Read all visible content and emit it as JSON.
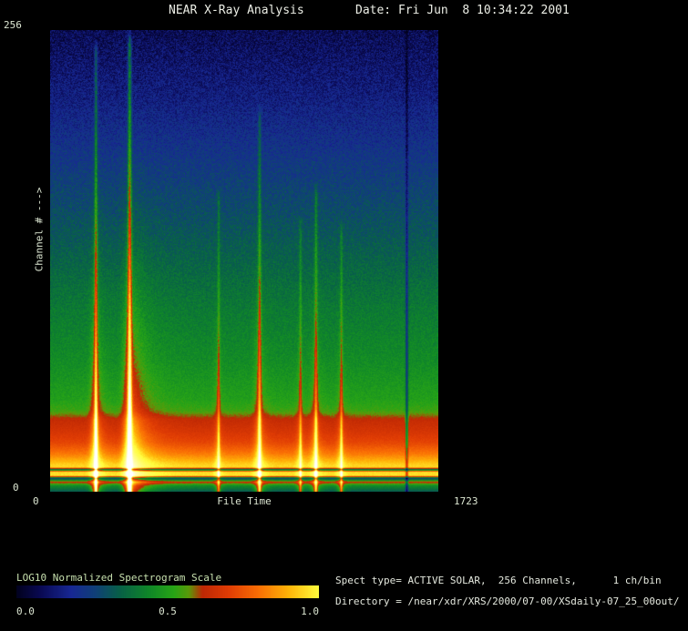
{
  "header": {
    "title": "NEAR X-Ray Analysis",
    "date": "Date: Fri Jun  8 10:34:22 2001"
  },
  "plot": {
    "y_axis": {
      "label": "Channel # --->",
      "max": "256",
      "min": "0"
    },
    "x_axis": {
      "label": "File Time",
      "min": "0",
      "max": "1723"
    }
  },
  "colorbar": {
    "title": "LOG10 Normalized Spectrogram Scale",
    "ticks": [
      "0.0",
      "0.5",
      "1.0"
    ]
  },
  "info": {
    "spect_type": "Spect type= ACTIVE SOLAR,  256 Channels,      1 ch/bin",
    "directory": "Directory = /near/xdr/XRS/2000/07-00/XSdaily-07_25_00out/"
  },
  "colors": {
    "background": "#000000",
    "text": "#dce6d2",
    "scale_title_text": "#c7e0ae"
  },
  "chart_data": {
    "type": "heatmap",
    "title": "NEAR X-Ray Analysis",
    "xlabel": "File Time",
    "ylabel": "Channel #",
    "xlim": [
      0,
      1723
    ],
    "ylim": [
      0,
      256
    ],
    "colorbar_label": "LOG10 Normalized Spectrogram Scale",
    "colorbar_range": [
      0.0,
      1.0
    ],
    "spect_type": "ACTIVE SOLAR",
    "n_channels": 256,
    "ch_per_bin": 1,
    "description": "Log10-normalized X-ray spectrogram. Background intensity rises toward low channel numbers (blue at high channels, green mid, red/orange/yellow bands at lowest channels). Vertical streaks are solar X-ray flare events at the listed file times; negative-amplitude entry is a dark data-dropout column.",
    "flare_events": [
      {
        "t": 202,
        "amp": 0.62,
        "top": 0.02,
        "core_w": 5,
        "tail": 20
      },
      {
        "t": 352,
        "amp": 0.88,
        "top": 0.0,
        "core_w": 6,
        "tail": 58
      },
      {
        "t": 748,
        "amp": 0.32,
        "top": 0.34,
        "core_w": 4,
        "tail": 10
      },
      {
        "t": 930,
        "amp": 0.46,
        "top": 0.16,
        "core_w": 5,
        "tail": 18
      },
      {
        "t": 1112,
        "amp": 0.3,
        "top": 0.4,
        "core_w": 4,
        "tail": 12
      },
      {
        "t": 1181,
        "amp": 0.42,
        "top": 0.33,
        "core_w": 5,
        "tail": 15
      },
      {
        "t": 1294,
        "amp": 0.34,
        "top": 0.41,
        "core_w": 4,
        "tail": 12
      },
      {
        "t": 1585,
        "amp": -0.3,
        "top": 0.0,
        "core_w": 4,
        "tail": 0
      }
    ],
    "background_profile": [
      [
        0.0,
        0.08
      ],
      [
        0.15,
        0.15
      ],
      [
        0.3,
        0.24
      ],
      [
        0.45,
        0.32
      ],
      [
        0.6,
        0.4
      ],
      [
        0.72,
        0.45
      ],
      [
        0.8,
        0.5
      ],
      [
        0.825,
        0.54
      ],
      [
        0.845,
        0.63
      ],
      [
        0.87,
        0.67
      ],
      [
        0.895,
        0.72
      ],
      [
        0.92,
        0.82
      ],
      [
        0.94,
        0.93
      ],
      [
        0.948,
        0.96
      ],
      [
        0.953,
        0.32
      ],
      [
        0.958,
        0.95
      ],
      [
        0.966,
        0.97
      ],
      [
        0.972,
        0.25
      ],
      [
        0.98,
        0.65
      ],
      [
        0.988,
        0.45
      ],
      [
        1.0,
        0.33
      ]
    ],
    "noise_profile": [
      [
        0.0,
        0.16
      ],
      [
        0.3,
        0.11
      ],
      [
        0.6,
        0.08
      ],
      [
        0.8,
        0.05
      ],
      [
        0.84,
        0.03
      ],
      [
        1.0,
        0.03
      ]
    ],
    "colormap_stops": [
      [
        0.0,
        [
          2,
          2,
          30
        ]
      ],
      [
        0.08,
        [
          10,
          10,
          84
        ]
      ],
      [
        0.18,
        [
          24,
          40,
          148
        ]
      ],
      [
        0.26,
        [
          16,
          64,
          120
        ]
      ],
      [
        0.34,
        [
          8,
          96,
          72
        ]
      ],
      [
        0.44,
        [
          16,
          136,
          40
        ]
      ],
      [
        0.52,
        [
          40,
          165,
          22
        ]
      ],
      [
        0.57,
        [
          90,
          155,
          10
        ]
      ],
      [
        0.615,
        [
          190,
          40,
          4
        ]
      ],
      [
        0.7,
        [
          224,
          60,
          4
        ]
      ],
      [
        0.8,
        [
          250,
          110,
          4
        ]
      ],
      [
        0.9,
        [
          255,
          180,
          8
        ]
      ],
      [
        1.0,
        [
          255,
          252,
          60
        ]
      ]
    ]
  }
}
